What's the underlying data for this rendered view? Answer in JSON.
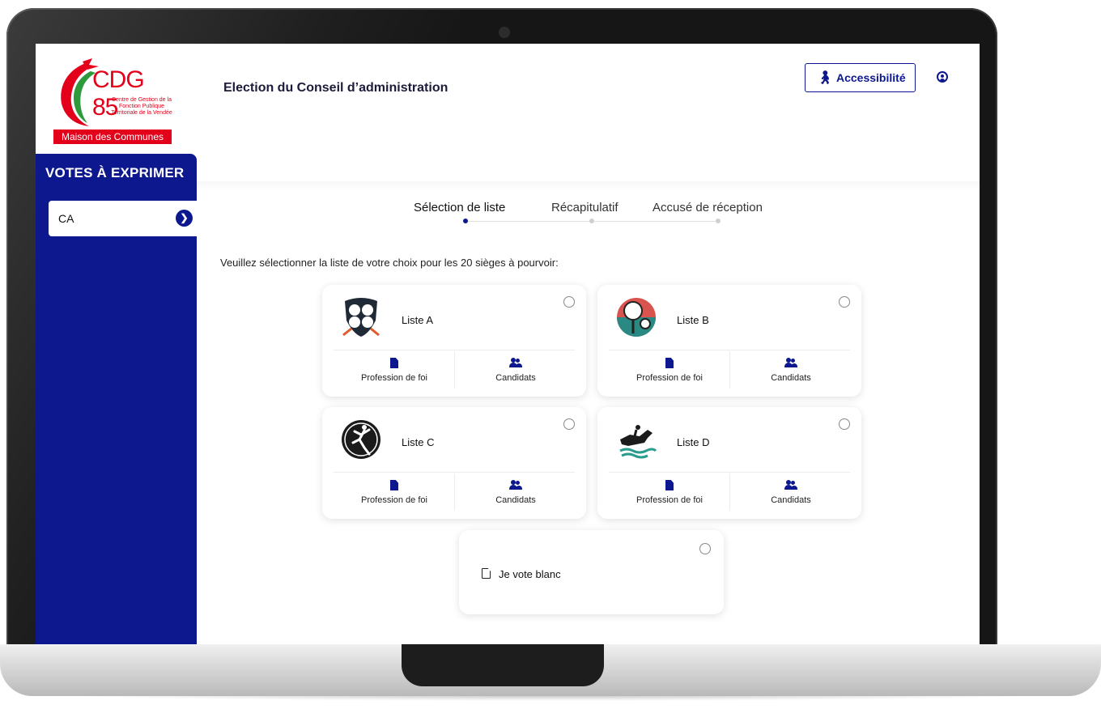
{
  "logo": {
    "name": "CDG 85",
    "subtitle": "Centre de Gestion de la Fonction Publique Territoriale de la Vendée",
    "band": "Maison des Communes"
  },
  "sidebar": {
    "title": "VOTES À EXPRIMER",
    "items": [
      {
        "label": "CA"
      }
    ]
  },
  "header": {
    "title": "Election du Conseil d’administration",
    "accessibility_label": "Accessibilité"
  },
  "stepper": {
    "steps": [
      "Sélection de liste",
      "Récapitulatif",
      "Accusé de réception"
    ],
    "active_index": 0
  },
  "instruction": "Veuillez sélectionner la liste de votre choix pour les 20 sièges à pourvoir:",
  "lists": [
    {
      "name": "Liste A",
      "emblem": "shield-sports-icon",
      "profession_label": "Profession de foi",
      "candidates_label": "Candidats",
      "selected": false
    },
    {
      "name": "Liste B",
      "emblem": "tennis-icon",
      "profession_label": "Profession de foi",
      "candidates_label": "Candidats",
      "selected": false
    },
    {
      "name": "Liste C",
      "emblem": "basketball-player-icon",
      "profession_label": "Profession de foi",
      "candidates_label": "Candidats",
      "selected": false
    },
    {
      "name": "Liste D",
      "emblem": "horse-rider-icon",
      "profession_label": "Profession de foi",
      "candidates_label": "Candidats",
      "selected": false
    }
  ],
  "blank_vote": {
    "label": "Je vote blanc",
    "selected": false
  },
  "colors": {
    "primary": "#0d188e",
    "brand_red": "#e2001a"
  }
}
